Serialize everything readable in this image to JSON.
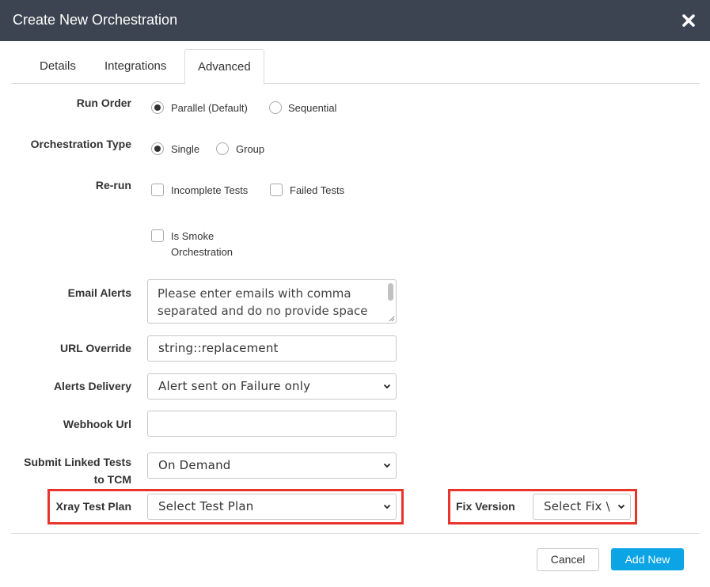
{
  "dialog": {
    "title": "Create New Orchestration",
    "close_icon": "close-icon"
  },
  "tabs": [
    {
      "label": "Details",
      "active": false
    },
    {
      "label": "Integrations",
      "active": false
    },
    {
      "label": "Advanced",
      "active": true
    }
  ],
  "form": {
    "run_order": {
      "label": "Run Order",
      "options": [
        {
          "label": "Parallel (Default)",
          "selected": true
        },
        {
          "label": "Sequential",
          "selected": false
        }
      ]
    },
    "orchestration_type": {
      "label": "Orchestration Type",
      "options": [
        {
          "label": "Single",
          "selected": true
        },
        {
          "label": "Group",
          "selected": false
        }
      ]
    },
    "rerun": {
      "label": "Re-run",
      "options": [
        {
          "label": "Incomplete Tests",
          "checked": false
        },
        {
          "label": "Failed Tests",
          "checked": false
        }
      ]
    },
    "is_smoke": {
      "line1": "Is Smoke",
      "line2": "Orchestration",
      "checked": false
    },
    "email_alerts": {
      "label": "Email Alerts",
      "placeholder": "Please enter emails with comma separated and do no provide space",
      "placeholder_line1": "Please enter emails with comma",
      "placeholder_line2": "separated and do no provide space"
    },
    "url_override": {
      "label": "URL Override",
      "value": "string::replacement"
    },
    "alerts_delivery": {
      "label": "Alerts Delivery",
      "value": "Alert sent on Failure only"
    },
    "webhook_url": {
      "label": "Webhook Url",
      "value": ""
    },
    "submit_linked_tests": {
      "label_line1": "Submit Linked Tests",
      "label_line2": "to TCM",
      "value": "On Demand"
    },
    "xray_test_plan": {
      "label": "Xray Test Plan",
      "value": "Select Test Plan"
    },
    "fix_version": {
      "label": "Fix Version",
      "value": "Select Fix \\"
    }
  },
  "footer": {
    "cancel_label": "Cancel",
    "add_label": "Add New"
  },
  "colors": {
    "header_bg": "#3d4451",
    "primary_button": "#0ba4e4",
    "highlight": "#e8352b"
  }
}
